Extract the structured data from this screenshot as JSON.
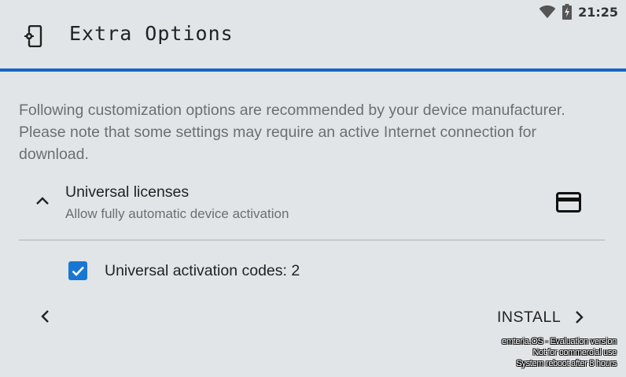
{
  "status_bar": {
    "time": "21:25",
    "icons": [
      "wifi-icon",
      "battery-charging-icon"
    ]
  },
  "header": {
    "icon": "phone-settings-icon",
    "title": "Extra Options",
    "accent_color": "#1565c0"
  },
  "description": "Following customization options are recommended by your device manufacturer. Please note that some settings may require an active Internet connection for download.",
  "section": {
    "title": "Universal licenses",
    "subtitle": "Allow fully automatic device activation",
    "expand_icon": "chevron-up-icon",
    "trailing_icon": "credit-card-icon"
  },
  "option": {
    "label": "Universal activation codes: 2",
    "checked": true,
    "checkbox_color": "#1976d2"
  },
  "navigation": {
    "back_icon": "chevron-left-icon",
    "install_label": "INSTALL",
    "install_icon": "chevron-right-icon"
  },
  "watermark": {
    "line1": "emteria.OS - Evaluation version",
    "line2": "Not for commercial use",
    "line3": "System reboot after 8 hours"
  }
}
